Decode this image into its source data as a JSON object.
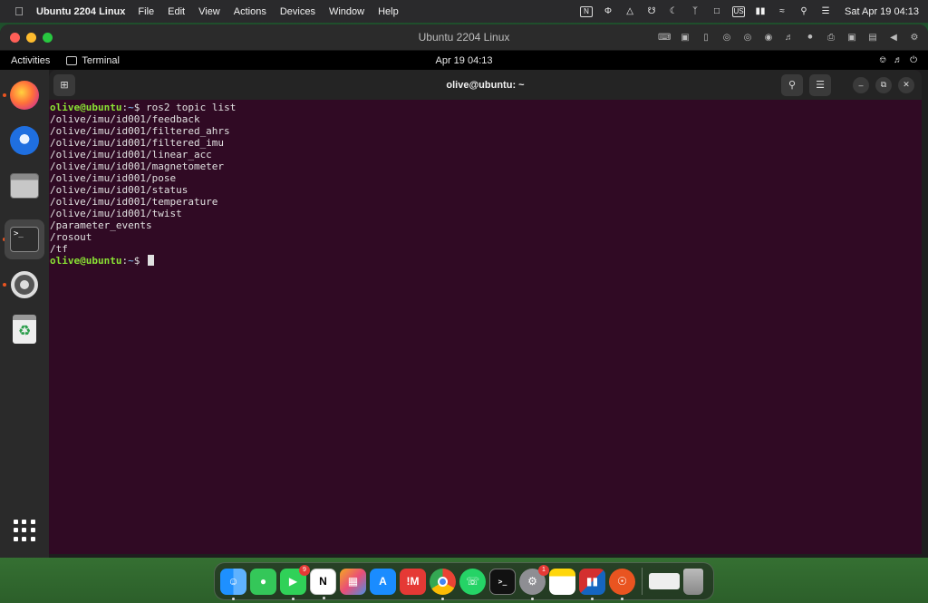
{
  "menubar": {
    "app_name": "Ubuntu 2204 Linux",
    "menus": [
      "File",
      "Edit",
      "View",
      "Actions",
      "Devices",
      "Window",
      "Help"
    ],
    "input_source": "US",
    "notion_badge": "N",
    "clock": "Sat Apr 19  04:13"
  },
  "vm": {
    "title": "Ubuntu 2204 Linux"
  },
  "ubuntu_topbar": {
    "activities": "Activities",
    "active_app": "Terminal",
    "datetime": "Apr 19  04:13"
  },
  "terminal": {
    "title": "olive@ubuntu: ~",
    "prompt_user": "olive@ubuntu",
    "prompt_path": "~",
    "command": "ros2 topic list",
    "output": [
      "/olive/imu/id001/feedback",
      "/olive/imu/id001/filtered_ahrs",
      "/olive/imu/id001/filtered_imu",
      "/olive/imu/id001/linear_acc",
      "/olive/imu/id001/magnetometer",
      "/olive/imu/id001/pose",
      "/olive/imu/id001/status",
      "/olive/imu/id001/temperature",
      "/olive/imu/id001/twist",
      "/parameter_events",
      "/rosout",
      "/tf"
    ],
    "term_icon_text": ">_"
  },
  "mac_dock": {
    "facetime_badge": "9",
    "settings_badge": "1",
    "notion_label": "N",
    "mindnode_label": "!M"
  },
  "colors": {
    "terminal_bg": "#300a24",
    "prompt_user": "#8ae234",
    "prompt_path": "#729fcf",
    "ubuntu_accent": "#e95420"
  }
}
